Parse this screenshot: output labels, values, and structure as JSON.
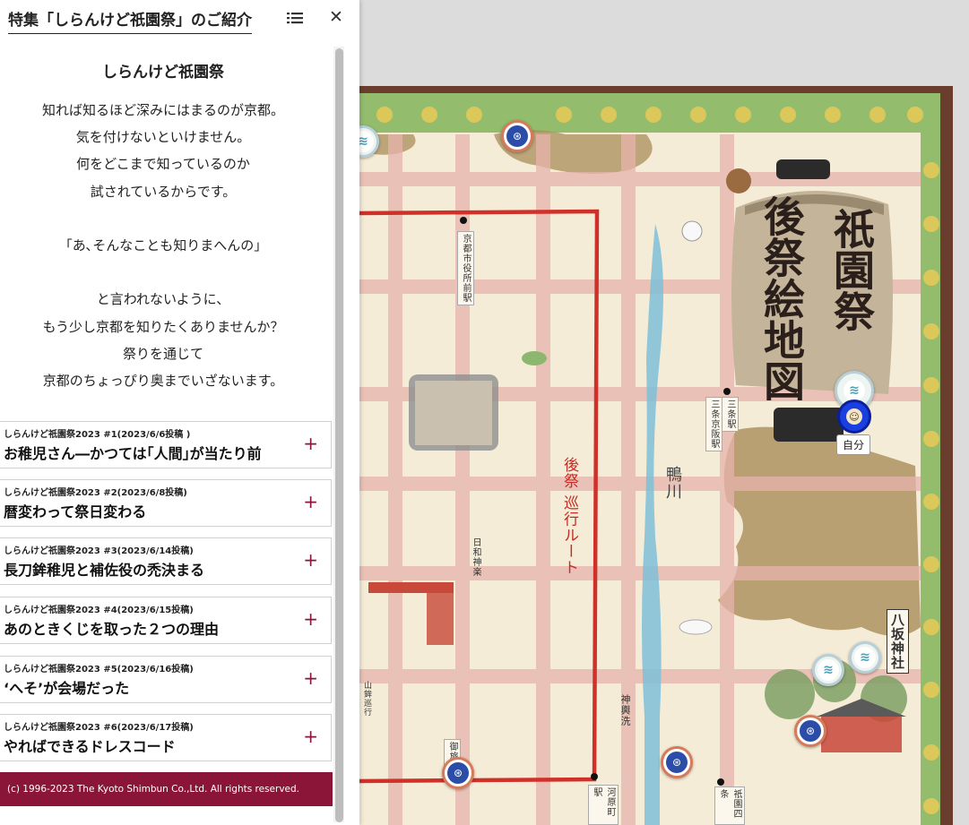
{
  "panel": {
    "title": "特集「しらんけど祇園祭」のご紹介",
    "toc_icon": "list-icon",
    "close_icon": "close-icon",
    "close_glyph": "✕",
    "intro_heading": "しらんけど祇園祭",
    "intro_lines": [
      "知れば知るほど深みにはまるのが京都。",
      "気を付けないといけません。",
      "何をどこまで知っているのか",
      "試されているからです。",
      "",
      "「あ､そんなことも知りまへんの」",
      "",
      "と言われないように、",
      "もう少し京都を知りたくありませんか？",
      "祭りを通じて",
      "京都のちょっぴり奥までいざないます。"
    ],
    "articles": [
      {
        "sub": "しらんけど祇園祭2023 #1(2023/6/6投稿 )",
        "title": "お稚児さん―かつては｢人間｣が当たり前"
      },
      {
        "sub": "しらんけど祇園祭2023 #2(2023/6/8投稿)",
        "title": "暦変わって祭日変わる"
      },
      {
        "sub": "しらんけど祇園祭2023 #3(2023/6/14投稿)",
        "title": "長刀鉾稚児と補佐役の禿決まる"
      },
      {
        "sub": "しらんけど祇園祭2023 #4(2023/6/15投稿)",
        "title": "あのときくじを取った２つの理由"
      },
      {
        "sub": "しらんけど祇園祭2023 #5(2023/6/16投稿)",
        "title": "‘へそ’が会場だった"
      },
      {
        "sub": "しらんけど祇園祭2023 #6(2023/6/17投稿)",
        "title": "やればできるドレスコード"
      }
    ],
    "expand_glyph": "+",
    "footer": "(c) 1996-2023 The Kyoto Shimbun Co.,Ltd. All rights reserved."
  },
  "map": {
    "title_lines": [
      "祇園祭",
      "後祭絵地図"
    ],
    "labels": {
      "station_shiyakusho": "京都市役所前駅",
      "station_sanjo_keihan": "三条京阪駅",
      "station_sanjo": "三条駅",
      "river": "鴨川",
      "route": "後祭 巡行ルート",
      "shrine": "八坂神社",
      "station_kawaramachi": "河原町駅",
      "station_gion": "祇園四条",
      "hiyori": "日和神楽",
      "shinyo": "神輿洗",
      "yamahoko": "山鉾巡行",
      "goryo": "御旅所"
    },
    "self_label": "自分",
    "colors": {
      "accent": "#8a1538",
      "paper": "#f4ecd6",
      "route": "#d0302a",
      "river": "#7ec0d8",
      "border_green": "#8fb86a",
      "frame": "#6b3d2e"
    },
    "markers": {
      "festival_icon": "tomoe-icon",
      "water_icon": "water-icon",
      "self_icon": "person-location-icon"
    }
  }
}
